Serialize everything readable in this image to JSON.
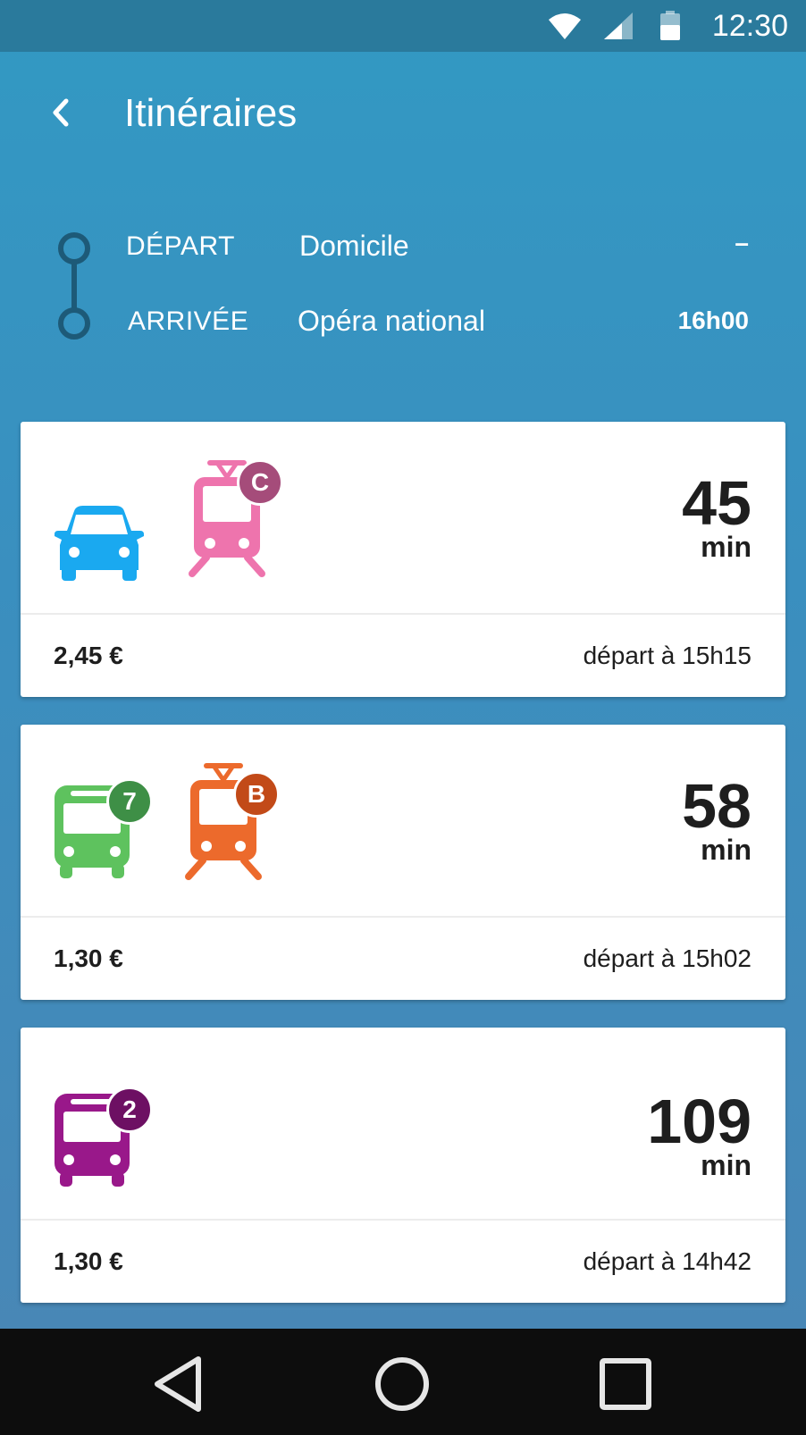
{
  "status_bar": {
    "time": "12:30",
    "icons": [
      "wifi-icon",
      "cell-signal-icon",
      "battery-icon"
    ]
  },
  "app_bar": {
    "title": "Itinéraires",
    "back_icon": "chevron-left-icon"
  },
  "route": {
    "departure": {
      "label": "DÉPART",
      "place": "Domicile",
      "time": "–"
    },
    "arrival": {
      "label": "ARRIVÉE",
      "place": "Opéra national",
      "time": "16h00"
    }
  },
  "itineraries": [
    {
      "modes": [
        {
          "type": "car-icon",
          "color": "#1aa9f0",
          "badge": ""
        },
        {
          "type": "tram-icon",
          "color": "#ee74ad",
          "badge": "C",
          "badge_color": "#a54c7a"
        }
      ],
      "duration": "45",
      "duration_unit": "min",
      "price": "2,45 €",
      "departure": "départ à 15h15"
    },
    {
      "modes": [
        {
          "type": "bus-icon",
          "color": "#5ec25e",
          "badge": "7",
          "badge_color": "#3e8f46"
        },
        {
          "type": "tram-icon",
          "color": "#ec6a2c",
          "badge": "B",
          "badge_color": "#c24a18"
        }
      ],
      "duration": "58",
      "duration_unit": "min",
      "price": "1,30 €",
      "departure": "départ à 15h02"
    },
    {
      "modes": [
        {
          "type": "bus-icon",
          "color": "#99188a",
          "badge": "2",
          "badge_color": "#6d1063"
        }
      ],
      "duration": "109",
      "duration_unit": "min",
      "price": "1,30 €",
      "departure": "départ à 14h42"
    }
  ],
  "nav_bar": {
    "buttons": [
      "back-triangle-icon",
      "home-circle-icon",
      "recents-square-icon"
    ]
  },
  "colors": {
    "status_bar": "#2a7a9c",
    "background_top": "#3299c3",
    "background_bottom": "#4a86b5",
    "route_line": "#1d5a78"
  }
}
